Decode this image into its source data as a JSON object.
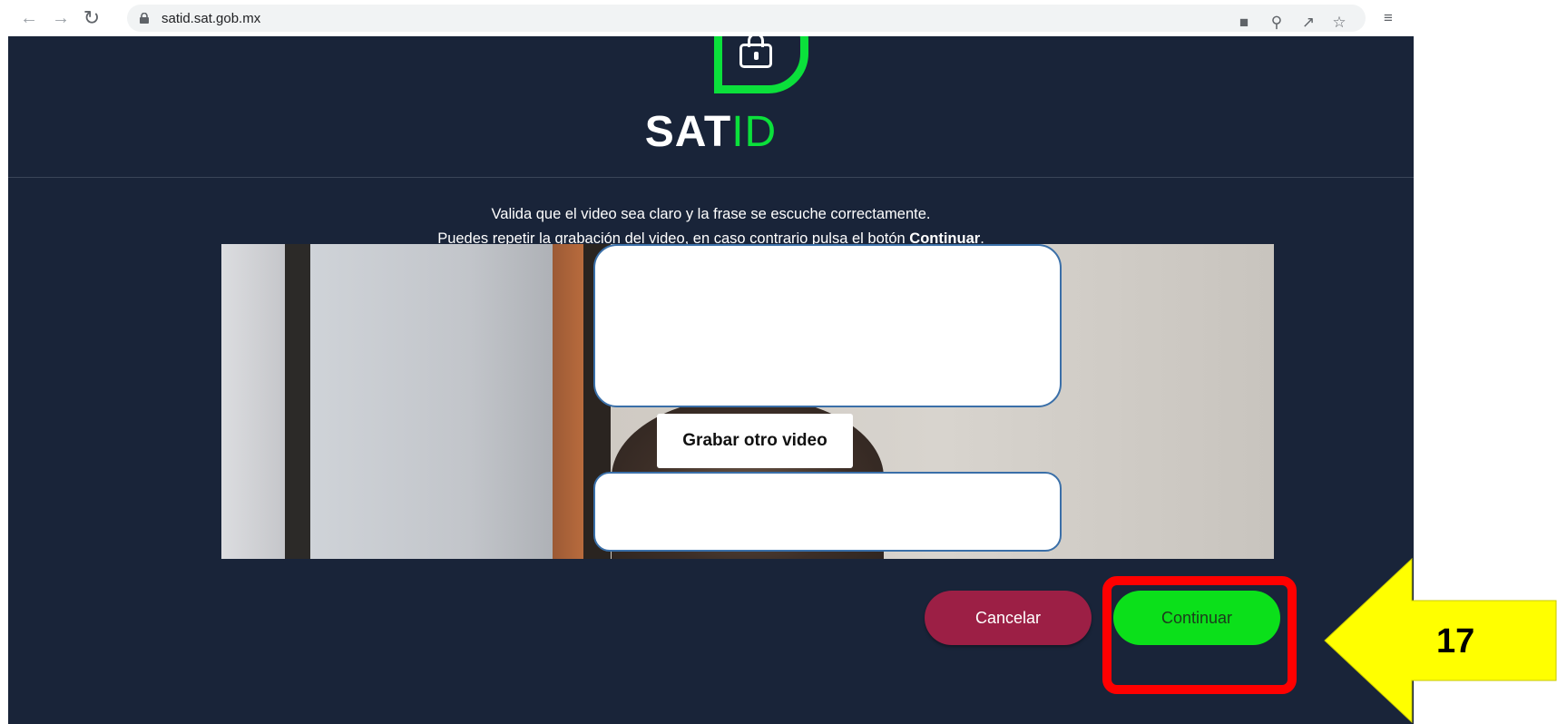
{
  "browser": {
    "url": "satid.sat.gob.mx",
    "icons": [
      "back-arrow-icon",
      "forward-arrow-icon",
      "reload-icon",
      "lock-icon",
      "camera-icon",
      "zoom-out-icon",
      "share-icon",
      "star-icon",
      "reading-list-icon"
    ]
  },
  "header": {
    "logo_text_sat": "SAT",
    "logo_text_id": "ID"
  },
  "instructions": {
    "line1": "Valida que el video sea claro y la frase se escuche correctamente.",
    "line2_prefix": "Puedes repetir la grabación del video, en caso contrario pulsa el botón ",
    "line2_bold": "Continuar",
    "line2_suffix": "."
  },
  "video": {
    "rerecord_label": "Grabar otro video"
  },
  "actions": {
    "cancel_label": "Cancelar",
    "continue_label": "Continuar"
  },
  "annotation": {
    "step_number": "17",
    "arrow_color": "#ffff00",
    "highlight_color": "#ff0000"
  },
  "colors": {
    "page_bg": "#192439",
    "brand_green": "#0be03b",
    "cancel_bg": "#9c1f45",
    "continue_bg": "#0be01a"
  }
}
